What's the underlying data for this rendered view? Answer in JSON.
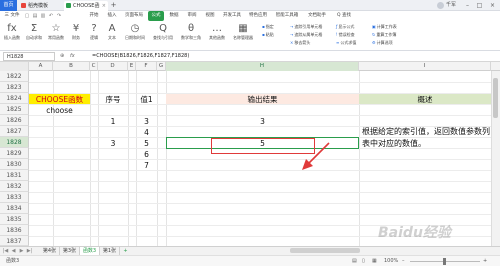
{
  "titlebar": {
    "app_label": "首页",
    "tabs": [
      {
        "label": "稻壳模板",
        "color": "#e8453c"
      },
      {
        "label": "CHOOSE函数.xls",
        "color": "#2a9d4c"
      }
    ],
    "user_name": "千军"
  },
  "menu": {
    "file_label": "三 文件",
    "items": [
      "开始",
      "插入",
      "页面布局",
      "公式",
      "数据",
      "审阅",
      "视图",
      "开发工具",
      "特色应用",
      "智能工具箱",
      "文档助手"
    ],
    "active": "公式",
    "search_label": "Q 查找"
  },
  "ribbon": {
    "large": [
      {
        "icon": "fx",
        "label": "插入函数"
      },
      {
        "icon": "Σ",
        "label": "自动求和"
      },
      {
        "icon": "☆",
        "label": "常用函数"
      },
      {
        "icon": "¥",
        "label": "财务"
      },
      {
        "icon": "?",
        "label": "逻辑"
      },
      {
        "icon": "A",
        "label": "文本"
      },
      {
        "icon": "◷",
        "label": "日期和时间"
      },
      {
        "icon": "Q",
        "label": "查找与引用"
      },
      {
        "icon": "θ",
        "label": "数学和三角"
      },
      {
        "icon": "…",
        "label": "其他函数"
      },
      {
        "icon": "▦",
        "label": "名称管理器"
      }
    ],
    "small": [
      "指定",
      "粘贴",
      "追踪引用单元格",
      "追踪从属单元格",
      "移去箭头",
      "显示公式",
      "错误检查",
      "公式求值",
      "计算工作表",
      "重算工作簿",
      "计算选项"
    ]
  },
  "formula_bar": {
    "name_box": "H1828",
    "fx_label": "fx",
    "formula": "=CHOOSE(B1826,F1826,F1827,F1828)"
  },
  "columns": [
    "A",
    "B",
    "C",
    "D",
    "E",
    "F",
    "G",
    "H",
    "I"
  ],
  "selected_column": "H",
  "rows": [
    "1822",
    "1823",
    "1824",
    "1825",
    "1826",
    "1827",
    "1828",
    "1829",
    "1830",
    "1831",
    "1832",
    "1833",
    "1834",
    "1835",
    "1836",
    "1837"
  ],
  "selected_row": "1828",
  "cells": {
    "choose_header": "CHOOSE函数",
    "choose_sub": "choose",
    "seq_header": "序号",
    "val_header": "值1",
    "output_header": "输出结果",
    "desc_header": "概述",
    "seq_values": [
      "1",
      "3"
    ],
    "val_values": [
      "3",
      "4",
      "5",
      "6",
      "7"
    ],
    "output_values": [
      "3",
      "5"
    ],
    "description": "根据给定的索引值，返回数值参数列表中对应的数值。"
  },
  "sheet_tabs": [
    "第4张",
    "第3张",
    "函数3",
    "第1张"
  ],
  "active_sheet": "函数3",
  "status": {
    "left": "函数3",
    "zoom": "100%"
  },
  "watermark": "Baidu经验"
}
